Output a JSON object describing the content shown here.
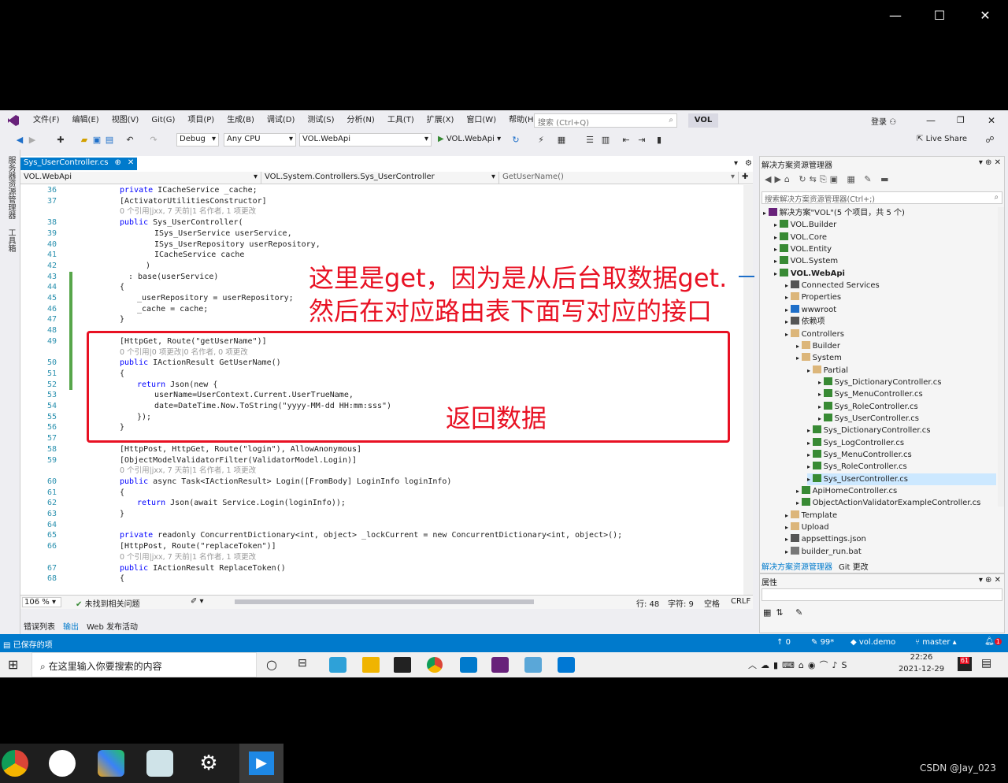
{
  "menu": [
    "文件(F)",
    "编辑(E)",
    "视图(V)",
    "Git(G)",
    "项目(P)",
    "生成(B)",
    "调试(D)",
    "测试(S)",
    "分析(N)",
    "工具(T)",
    "扩展(X)",
    "窗口(W)",
    "帮助(H)"
  ],
  "search_placeholder": "搜索 (Ctrl+Q)",
  "solution_short": "VOL",
  "login_label": "登录",
  "toolbar": {
    "config": "Debug",
    "platform": "Any CPU",
    "startup": "VOL.WebApi",
    "run": "VOL.WebApi",
    "live_share": "Live Share"
  },
  "left_tabs": [
    "服务器资源管理器",
    "工具箱"
  ],
  "doc_tab": {
    "name": "Sys_UserController.cs",
    "pin": "⊕",
    "close": "✕"
  },
  "nav": {
    "project": "VOL.WebApi",
    "class": "VOL.System.Controllers.Sys_UserController",
    "member": "GetUserName()"
  },
  "code_lines": [
    {
      "n": "36",
      "t": "private ICacheService _cache;",
      "i": 0
    },
    {
      "n": "37",
      "t": "[ActivatorUtilitiesConstructor]",
      "i": 0
    },
    {
      "n": "",
      "t": "0 个引用|jxx, 7 天前|1 名作者, 1 项更改",
      "i": 0,
      "hint": true
    },
    {
      "n": "38",
      "t": "public Sys_UserController(",
      "i": 0
    },
    {
      "n": "39",
      "t": "ISys_UserService userService,",
      "i": 4
    },
    {
      "n": "40",
      "t": "ISys_UserRepository userRepository,",
      "i": 4
    },
    {
      "n": "41",
      "t": "ICacheService cache",
      "i": 4
    },
    {
      "n": "42",
      "t": ")",
      "i": 3
    },
    {
      "n": "43",
      "t": ": base(userService)",
      "i": 1
    },
    {
      "n": "44",
      "t": "{",
      "i": 0
    },
    {
      "n": "45",
      "t": "_userRepository = userRepository;",
      "i": 2
    },
    {
      "n": "46",
      "t": "_cache = cache;",
      "i": 2
    },
    {
      "n": "47",
      "t": "}",
      "i": 0
    },
    {
      "n": "48",
      "t": "",
      "i": 0
    },
    {
      "n": "49",
      "t": "[HttpGet, Route(\"getUserName\")]",
      "i": 0
    },
    {
      "n": "",
      "t": "0 个引用|0 项更改|0 名作者, 0 项更改",
      "i": 0,
      "hint": true
    },
    {
      "n": "50",
      "t": "public IActionResult GetUserName()",
      "i": 0
    },
    {
      "n": "51",
      "t": "{",
      "i": 0
    },
    {
      "n": "52",
      "t": "return Json(new {",
      "i": 2
    },
    {
      "n": "53",
      "t": "userName=UserContext.Current.UserTrueName,",
      "i": 4
    },
    {
      "n": "54",
      "t": "date=DateTime.Now.ToString(\"yyyy-MM-dd HH:mm:sss\")",
      "i": 4
    },
    {
      "n": "55",
      "t": "});",
      "i": 2
    },
    {
      "n": "56",
      "t": "}",
      "i": 0
    },
    {
      "n": "57",
      "t": "",
      "i": 0
    },
    {
      "n": "58",
      "t": "[HttpPost, HttpGet, Route(\"login\"), AllowAnonymous]",
      "i": 0
    },
    {
      "n": "59",
      "t": "[ObjectModelValidatorFilter(ValidatorModel.Login)]",
      "i": 0
    },
    {
      "n": "",
      "t": "0 个引用|jxx, 7 天前|1 名作者, 1 项更改",
      "i": 0,
      "hint": true
    },
    {
      "n": "60",
      "t": "public async Task<IActionResult> Login([FromBody] LoginInfo loginInfo)",
      "i": 0
    },
    {
      "n": "61",
      "t": "{",
      "i": 0
    },
    {
      "n": "62",
      "t": "return Json(await Service.Login(loginInfo));",
      "i": 2
    },
    {
      "n": "63",
      "t": "}",
      "i": 0
    },
    {
      "n": "64",
      "t": "",
      "i": 0
    },
    {
      "n": "65",
      "t": "private readonly ConcurrentDictionary<int, object> _lockCurrent = new ConcurrentDictionary<int, object>();",
      "i": 0
    },
    {
      "n": "66",
      "t": "[HttpPost, Route(\"replaceToken\")]",
      "i": 0
    },
    {
      "n": "",
      "t": "0 个引用|jxx, 7 天前|1 名作者, 1 项更改",
      "i": 0,
      "hint": true
    },
    {
      "n": "67",
      "t": "public IActionResult ReplaceToken()",
      "i": 0
    },
    {
      "n": "68",
      "t": "{",
      "i": 0
    }
  ],
  "annotations": {
    "line1": "这里是get，因为是从后台取数据get.",
    "line2": "然后在对应路由表下面写对应的接口",
    "return_data": "返回数据"
  },
  "editor_status": {
    "zoom": "106 %",
    "issues": "未找到相关问题",
    "line": "行: 48",
    "col": "字符: 9",
    "spaces": "空格",
    "eol": "CRLF"
  },
  "bottom_tabs": [
    "错误列表",
    "输出",
    "Web 发布活动"
  ],
  "solution_explorer": {
    "title": "解决方案资源管理器",
    "search": "搜索解决方案资源管理器(Ctrl+;)",
    "items": [
      {
        "label": "解决方案\"VOL\"(5 个项目，共 5 个)",
        "indent": 0,
        "icon": "solution-icon"
      },
      {
        "label": "VOL.Builder",
        "indent": 1,
        "icon": "project-icon"
      },
      {
        "label": "VOL.Core",
        "indent": 1,
        "icon": "project-icon"
      },
      {
        "label": "VOL.Entity",
        "indent": 1,
        "icon": "project-icon"
      },
      {
        "label": "VOL.System",
        "indent": 1,
        "icon": "project-icon"
      },
      {
        "label": "VOL.WebApi",
        "indent": 1,
        "icon": "project-icon",
        "bold": true
      },
      {
        "label": "Connected Services",
        "indent": 2,
        "icon": "connected-icon"
      },
      {
        "label": "Properties",
        "indent": 2,
        "icon": "folder-icon"
      },
      {
        "label": "wwwroot",
        "indent": 2,
        "icon": "globe-icon"
      },
      {
        "label": "依赖项",
        "indent": 2,
        "icon": "dependency-icon"
      },
      {
        "label": "Controllers",
        "indent": 2,
        "icon": "folder-icon"
      },
      {
        "label": "Builder",
        "indent": 3,
        "icon": "folder-icon"
      },
      {
        "label": "System",
        "indent": 3,
        "icon": "folder-icon"
      },
      {
        "label": "Partial",
        "indent": 4,
        "icon": "folder-icon"
      },
      {
        "label": "Sys_DictionaryController.cs",
        "indent": 5,
        "icon": "cs-file-icon"
      },
      {
        "label": "Sys_MenuController.cs",
        "indent": 5,
        "icon": "cs-file-icon"
      },
      {
        "label": "Sys_RoleController.cs",
        "indent": 5,
        "icon": "cs-file-icon"
      },
      {
        "label": "Sys_UserController.cs",
        "indent": 5,
        "icon": "cs-file-icon"
      },
      {
        "label": "Sys_DictionaryController.cs",
        "indent": 4,
        "icon": "cs-file-icon"
      },
      {
        "label": "Sys_LogController.cs",
        "indent": 4,
        "icon": "cs-file-icon"
      },
      {
        "label": "Sys_MenuController.cs",
        "indent": 4,
        "icon": "cs-file-icon"
      },
      {
        "label": "Sys_RoleController.cs",
        "indent": 4,
        "icon": "cs-file-icon"
      },
      {
        "label": "Sys_UserController.cs",
        "indent": 4,
        "icon": "cs-file-icon",
        "selected": true
      },
      {
        "label": "ApiHomeController.cs",
        "indent": 3,
        "icon": "cs-file-icon"
      },
      {
        "label": "ObjectActionValidatorExampleController.cs",
        "indent": 3,
        "icon": "cs-file-icon"
      },
      {
        "label": "Template",
        "indent": 2,
        "icon": "folder-icon"
      },
      {
        "label": "Upload",
        "indent": 2,
        "icon": "folder-icon"
      },
      {
        "label": "appsettings.json",
        "indent": 2,
        "icon": "json-icon"
      },
      {
        "label": "builder_run.bat",
        "indent": 2,
        "icon": "file-icon"
      }
    ],
    "tabs": [
      "解决方案资源管理器",
      "Git 更改"
    ]
  },
  "properties_title": "属性",
  "statusbar": {
    "saved": "已保存的项",
    "errors": "0",
    "arrows": "99*",
    "repo": "vol.demo",
    "branch": "master",
    "notif": "1"
  },
  "taskbar": {
    "search": "在这里输入你要搜索的内容",
    "time": "22:26",
    "date": "2021-12-29",
    "badge": "61"
  },
  "watermark": "CSDN @Jay_023",
  "colors": {
    "accent": "#007acc",
    "annotation": "#e81123",
    "selection": "#cce8ff"
  }
}
